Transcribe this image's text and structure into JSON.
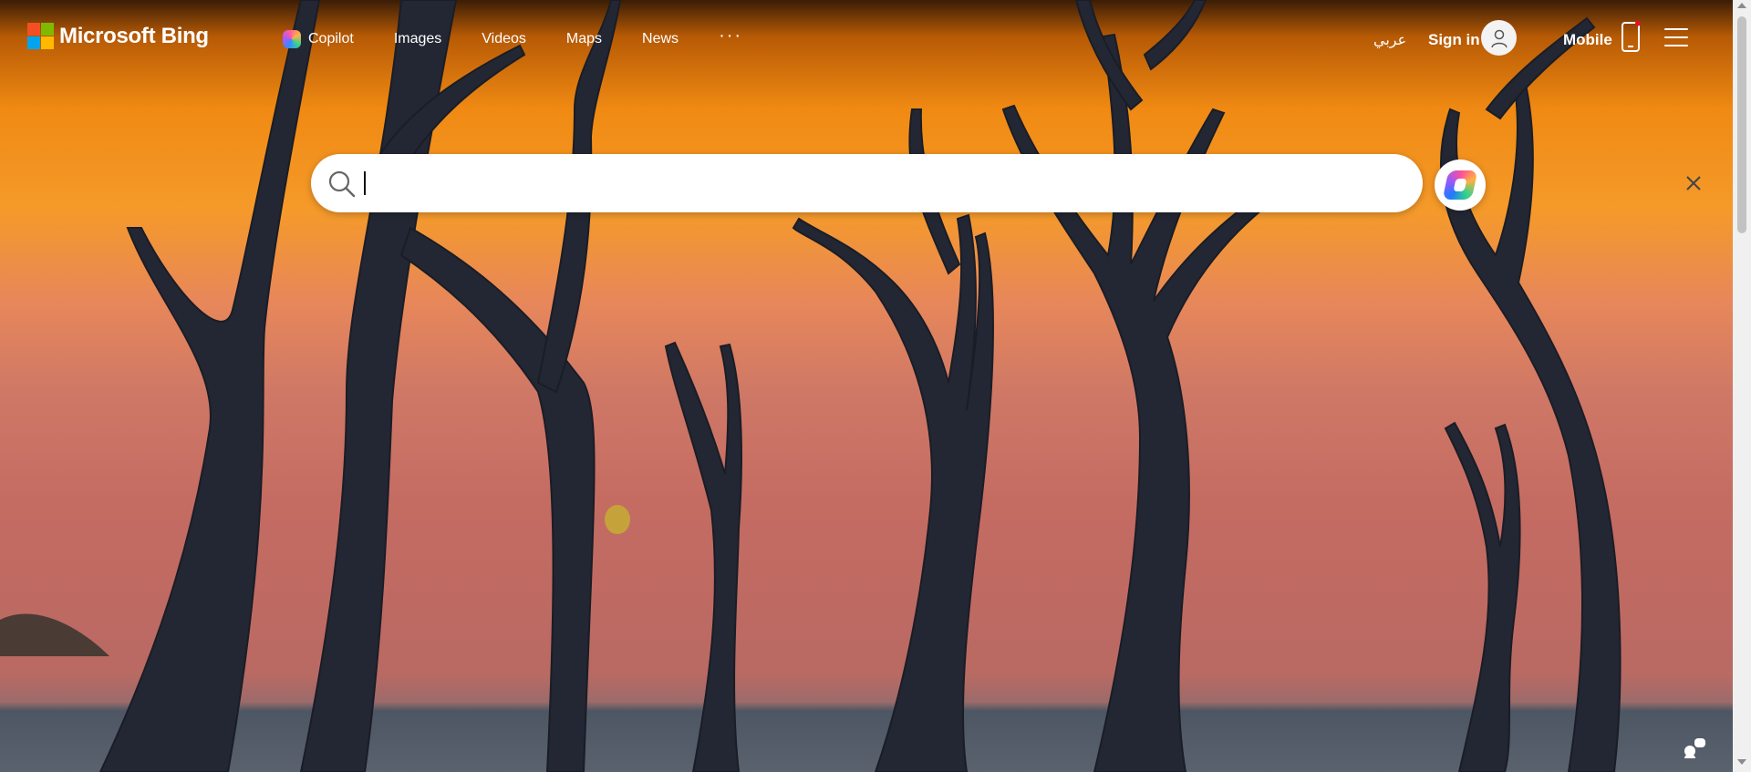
{
  "brand": {
    "name": "Microsoft Bing",
    "logo_colors": [
      "#f25022",
      "#7fba00",
      "#00a4ef",
      "#ffb900"
    ]
  },
  "nav": {
    "items": [
      {
        "label": "Copilot",
        "icon": "copilot-icon"
      },
      {
        "label": "Images"
      },
      {
        "label": "Videos"
      },
      {
        "label": "Maps"
      },
      {
        "label": "News"
      }
    ],
    "more_label": "···"
  },
  "header_right": {
    "language": "عربي",
    "sign_in": "Sign in",
    "mobile": "Mobile"
  },
  "search": {
    "value": "",
    "placeholder": ""
  },
  "background": {
    "subject": "dead camelthorn trees against orange dune",
    "accent": "#f08a13"
  }
}
